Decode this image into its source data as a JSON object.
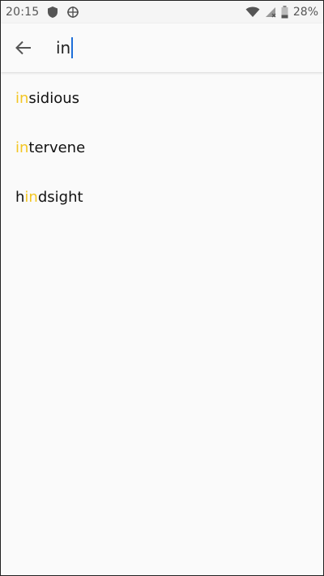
{
  "status_bar": {
    "time": "20:15",
    "battery": "28%",
    "icons": [
      "shield-icon",
      "crosshair-icon",
      "wifi-icon",
      "signal-icon",
      "battery-icon"
    ]
  },
  "search": {
    "query": "in",
    "back_icon": "arrow-left-icon"
  },
  "colors": {
    "highlight": "#f3c623",
    "caret": "#1e6fd9",
    "background": "#fafafa"
  },
  "results": [
    {
      "pre": "",
      "match": "in",
      "post": "sidious"
    },
    {
      "pre": "",
      "match": "in",
      "post": "tervene"
    },
    {
      "pre": "h",
      "match": "in",
      "post": "dsight"
    }
  ]
}
